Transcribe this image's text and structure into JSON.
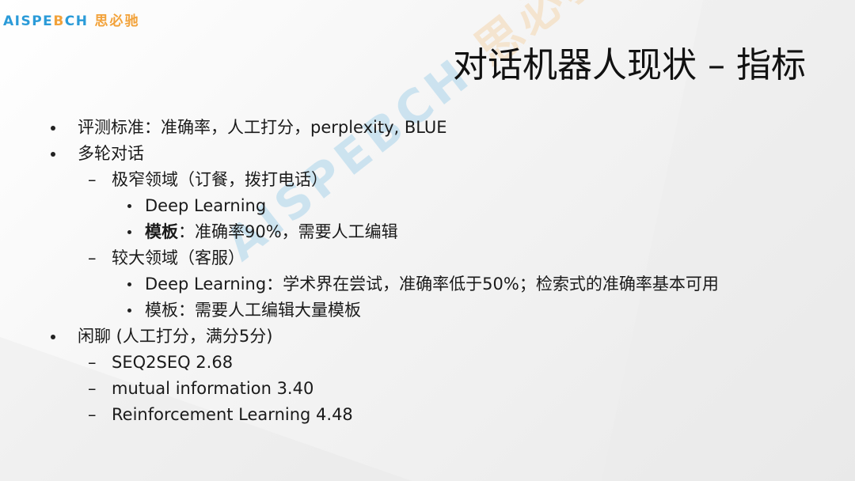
{
  "logo": {
    "text_en_part1": "AISPE",
    "text_en_part2": "B",
    "text_en_part3": "CH",
    "text_cn": "思必驰"
  },
  "watermark": {
    "en": "AISPEBCH",
    "cn": "思必驰"
  },
  "title": "对话机器人现状 – 指标",
  "items": {
    "i1": "评测标准：准确率，人工打分，perplexity, BLUE",
    "i2": "多轮对话",
    "i2a": "极窄领域（订餐，拨打电话）",
    "i2a1": "Deep Learning",
    "i2a2_bold": "模板",
    "i2a2_rest": "：准确率90%，需要人工编辑",
    "i2b": "较大领域（客服）",
    "i2b1": "Deep Learning：学术界在尝试，准确率低于50%；检索式的准确率基本可用",
    "i2b2": "模板：需要人工编辑大量模板",
    "i3": "闲聊 (人工打分，满分5分)",
    "i3a": "SEQ2SEQ 2.68",
    "i3b": "mutual information 3.40",
    "i3c": "Reinforcement Learning 4.48"
  },
  "dash_symbol": "–",
  "colors": {
    "accent_blue": "#2b9bd8",
    "accent_orange": "#f2a23a",
    "text": "#1a1a1a"
  }
}
